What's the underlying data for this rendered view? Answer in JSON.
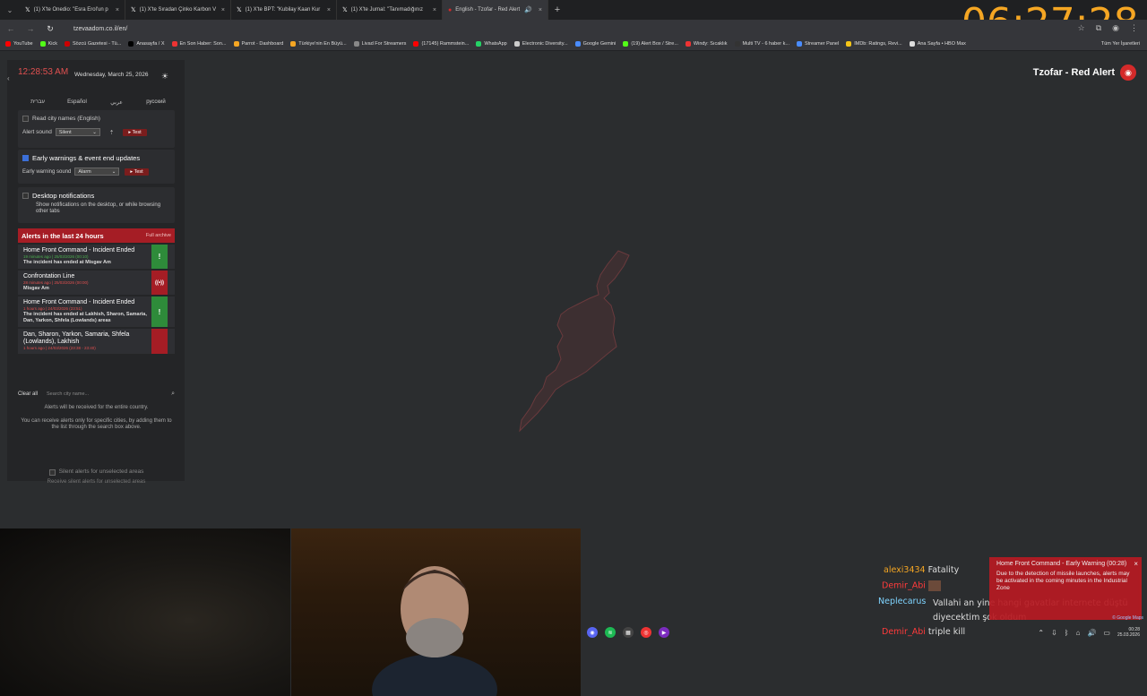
{
  "browser": {
    "tabs": [
      {
        "label": "(1) X'te Onedio: \"Esra Erol'un p",
        "active": false
      },
      {
        "label": "(1) X'te Sıradan Çinko Karbon V",
        "active": false
      },
      {
        "label": "(1) X'te BPT: \"Kubilay Kaan Kur",
        "active": false
      },
      {
        "label": "(1) X'te Jurnal: \"Tanımadığınız",
        "active": false
      },
      {
        "label": "English - Tzofar - Red Alert",
        "active": true
      }
    ],
    "url": "tzevaadom.co.il/en/",
    "bookmarks": [
      {
        "label": "YouTube",
        "color": "#ff0000"
      },
      {
        "label": "Kick",
        "color": "#53fc18"
      },
      {
        "label": "Sözcü Gazetesi - Tü...",
        "color": "#c00"
      },
      {
        "label": "Anasayfa / X",
        "color": "#000"
      },
      {
        "label": "En Son Haber: Son...",
        "color": "#e33"
      },
      {
        "label": "Parrot - Dashboard",
        "color": "#f5a623"
      },
      {
        "label": "Türkiye'nin En Büyü...",
        "color": "#f5a623"
      },
      {
        "label": "Livad For Streamers",
        "color": "#888"
      },
      {
        "label": "(17145) Rammstein...",
        "color": "#ff0000"
      },
      {
        "label": "WhatsApp",
        "color": "#25d366"
      },
      {
        "label": "Electronic Diversity...",
        "color": "#ccc"
      },
      {
        "label": "Google Gemini",
        "color": "#4a8cff"
      },
      {
        "label": "(19) Alert Box / Stre...",
        "color": "#53fc18"
      },
      {
        "label": "Windy: Sıcaklık",
        "color": "#e33"
      },
      {
        "label": "Multi TV - 6 haber k...",
        "color": "#333"
      },
      {
        "label": "Streamer Panel",
        "color": "#4a8cff"
      },
      {
        "label": "IMDb: Ratings, Revi...",
        "color": "#f5c518"
      },
      {
        "label": "Ana Sayfa • HBO Max",
        "color": "#ddd"
      }
    ],
    "bookmarks_right": "Tüm Yer İşaretleri"
  },
  "overlay_clock": "06:27:28",
  "sidebar": {
    "time": "12:28:53 AM",
    "date": "Wednesday, March 25, 2026",
    "languages": [
      "עברית",
      "Español",
      "عربي",
      "русский"
    ],
    "read_city_names": "Read city names (English)",
    "alert_sound_label": "Alert sound",
    "alert_sound_value": "Silent",
    "test_label": "▸ Test",
    "early_warnings_label": "Early warnings & event end updates",
    "early_sound_label": "Early warning sound",
    "early_sound_value": "Alarm",
    "desktop_notif_label": "Desktop notifications",
    "desktop_notif_desc": "Show notifications on the desktop, or while browsing other tabs",
    "alerts_title": "Alerts in the last 24 hours",
    "full_archive": "Full archive",
    "alerts": [
      {
        "title": "Home Front Command - Incident Ended",
        "meta": "19 minutes ago | 25/03/2026 (00:10)",
        "body": "The incident has ended at Misgav Am",
        "type": "green",
        "icon": "!"
      },
      {
        "title": "Confrontation Line",
        "meta": "28 minutes ago | 25/03/2026 (00:00)",
        "body": "Misgav Am",
        "type": "red",
        "icon": "((•))"
      },
      {
        "title": "Home Front Command - Incident Ended",
        "meta": "1 hours ago | 24/03/2026 (23:51)",
        "body": "The incident has ended at Lakhish, Sharon, Samaria, Dan, Yarkon, Shfela (Lowlands) areas",
        "type": "green",
        "icon": "!"
      },
      {
        "title": "Dan, Sharon, Yarkon, Samaria, Shfela (Lowlands), Lakhish",
        "meta": "1 hours ago | 24/03/2026 (23:38 - 23:40)",
        "body": "",
        "type": "red",
        "icon": ""
      }
    ],
    "clear_all": "Clear all",
    "search_placeholder": "Search city name...",
    "info1": "Alerts will be received for the entire country.",
    "info2": "You can receive alerts only for specific cities, by adding them to the list through the search box above.",
    "silent_label": "Silent alerts for unselected areas",
    "silent_desc": "Receive silent alerts for unselected areas"
  },
  "brand": {
    "name": "Tzofar - Red Alert"
  },
  "chat": [
    {
      "user": "alexi3434",
      "msg": "Fatality",
      "color": "#f5a623"
    },
    {
      "user": "Demir_Abi",
      "msg": "",
      "color": "#ff3b3b"
    },
    {
      "user": "Neplecarus",
      "msg": "Vallahi an yine hangi gavatlar internete düştü diyecektim şok oldum",
      "color": "#7fd4ff"
    },
    {
      "user": "Demir_Abi",
      "msg": "triple kill",
      "color": "#ff3b3b"
    }
  ],
  "toast": {
    "title": "Home Front Command - Early Warning (00:28)",
    "body": "Due to the detection of missile launches, alerts may be activated in the coming minutes in the Industrial Zone"
  },
  "map_attribution": "© Google Maps",
  "tray": {
    "time": "00:28",
    "date": "25.03.2026"
  }
}
